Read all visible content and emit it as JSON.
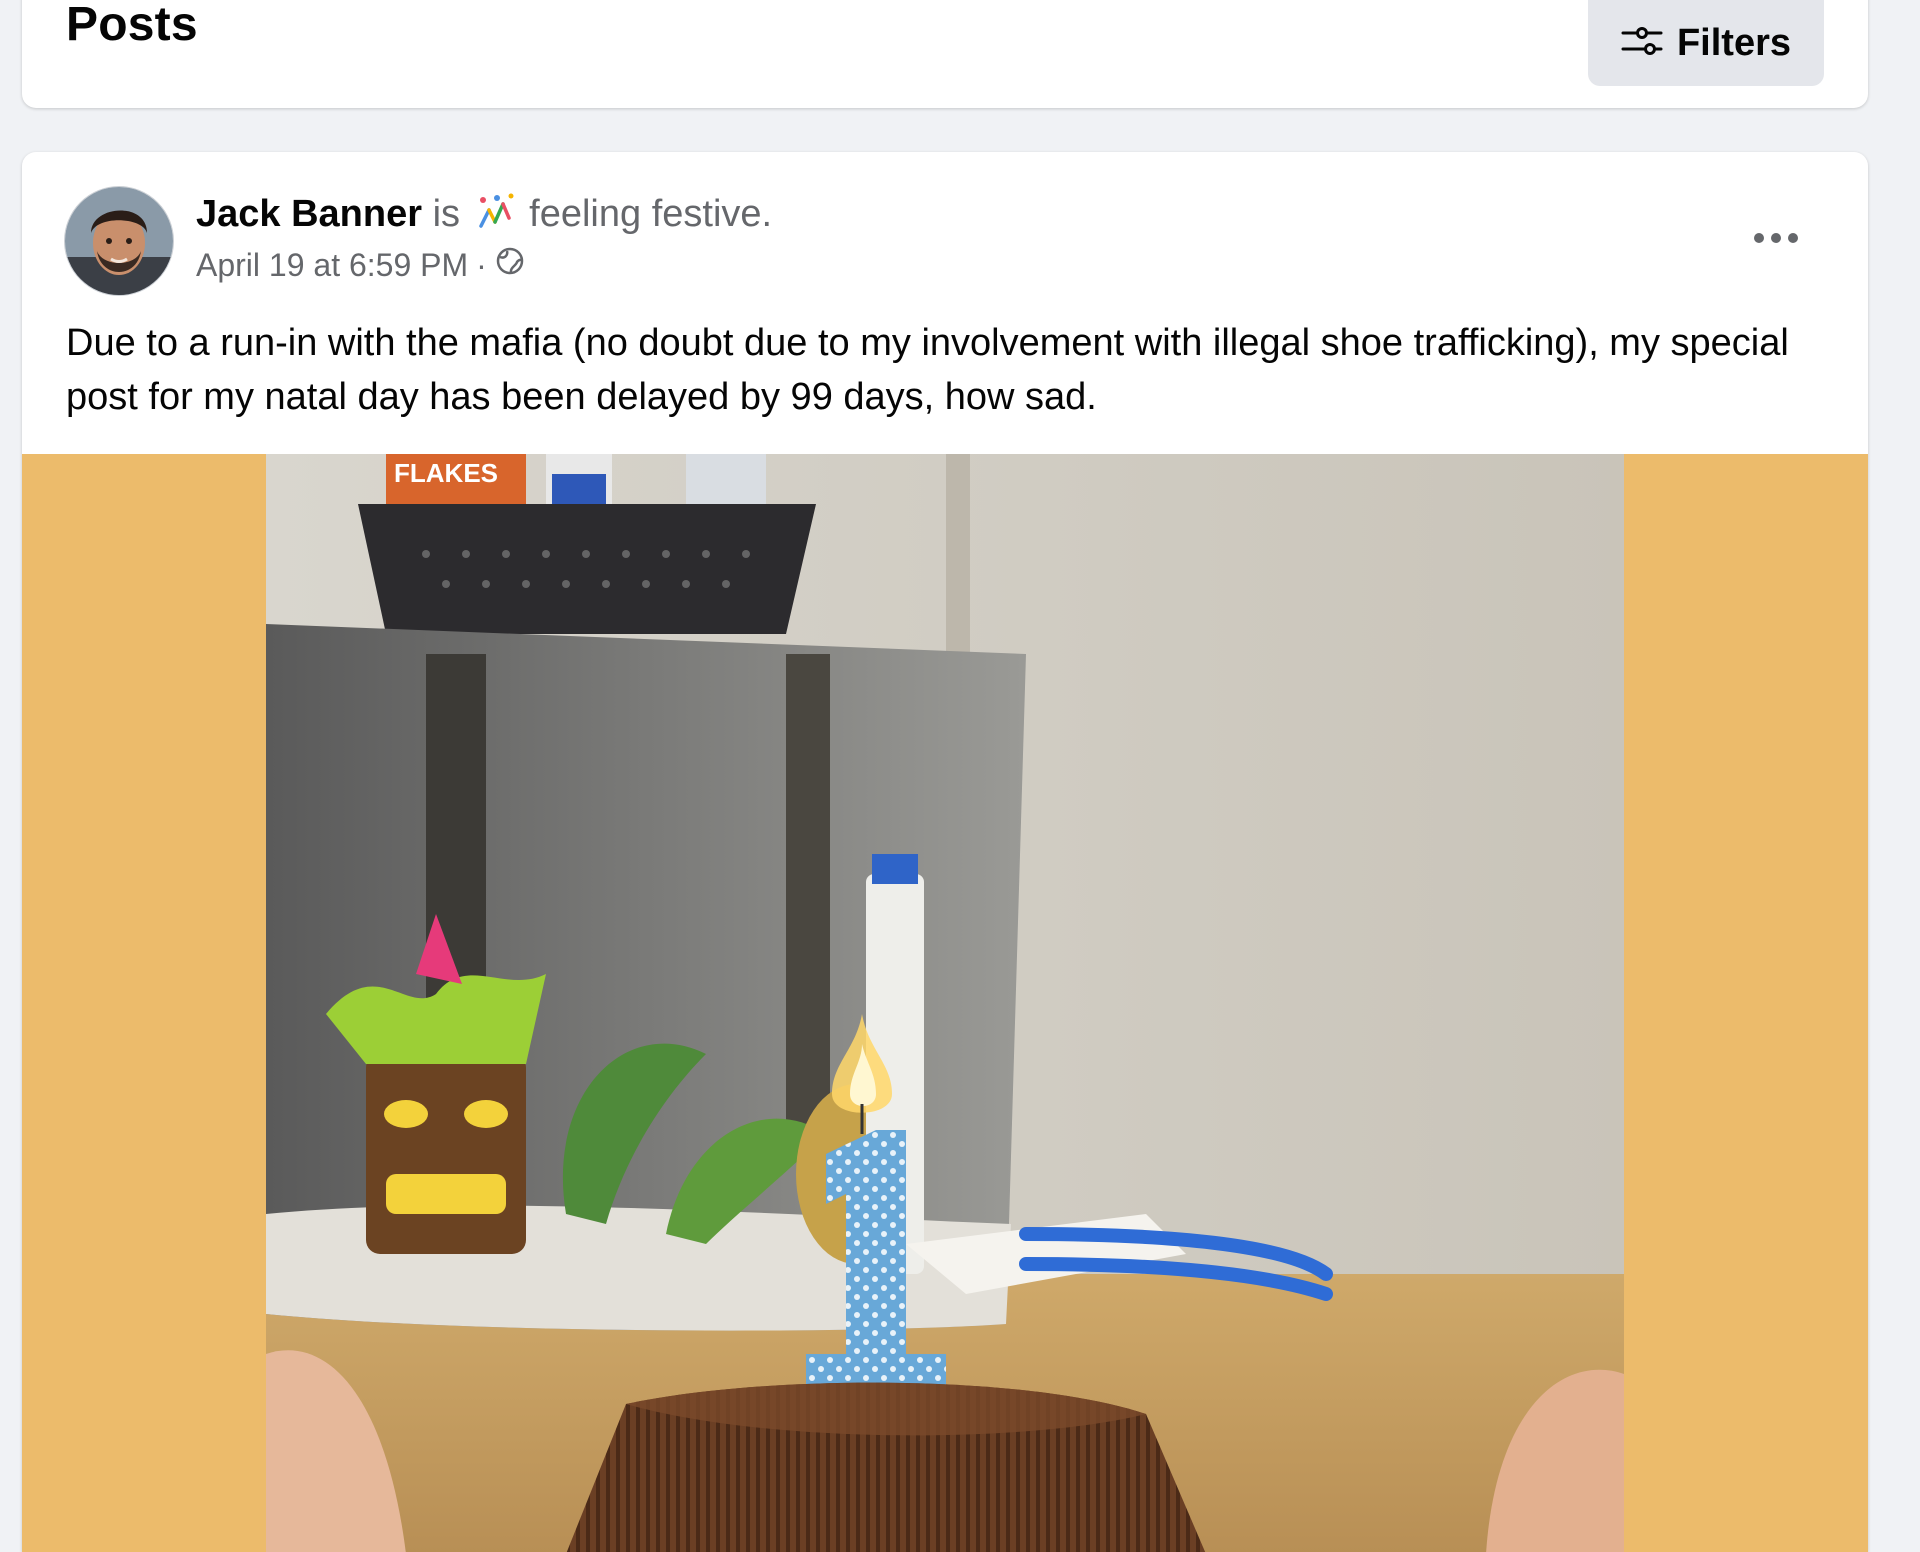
{
  "header": {
    "title": "Posts",
    "filters_label": "Filters",
    "filters_icon": "sliders-icon"
  },
  "post": {
    "author": "Jack Banner",
    "activity_prefix": "is",
    "feeling_icon": "festive-confetti-icon",
    "feeling_text": "feeling festive.",
    "timestamp": "April 19 at 6:59 PM",
    "separator": "·",
    "privacy_icon": "globe-icon",
    "menu_icon": "more-options-icon",
    "text": "Due to a run-in with the mafia (no doubt due to my involvement with illegal shoe trafficking), my special post for my natal day has been delayed by 99 days, how sad.",
    "photo_letterbox_color": "#ecbb6b",
    "photo_text": {
      "box_label": "FLAKES",
      "candle_number": "1"
    }
  }
}
